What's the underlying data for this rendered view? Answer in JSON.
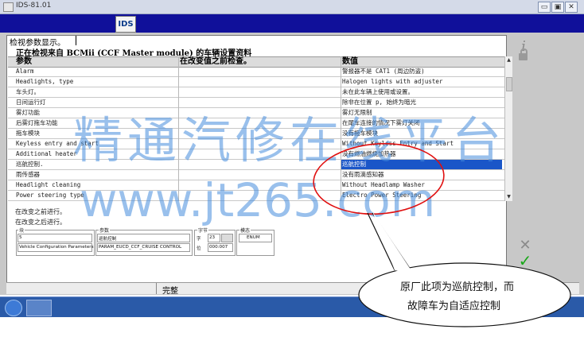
{
  "window": {
    "title": "IDS-81.01",
    "minimize": "▭",
    "restore": "▣",
    "close": "✕"
  },
  "toolbar": {
    "logo_label": "IDS"
  },
  "main": {
    "heading": "检视参数显示。",
    "subheading": "正在检视来自 BCMii (CCF Master module) 的车辆设置资料",
    "columns": [
      "参数",
      "在改变值之前检查。",
      "数值"
    ],
    "rows": [
      {
        "param": "Alarm",
        "value": "警报器不是 CAT1 (周边防盗)"
      },
      {
        "param": "Headlights, type",
        "value": "Halogen lights with adjuster"
      },
      {
        "param": "车头灯。",
        "value": "未在此车辆上使用或设置。"
      },
      {
        "param": "日间运行灯",
        "value": "除非在位置 p, 始终为暗光"
      },
      {
        "param": "雾灯功能",
        "value": "雾灯无限制"
      },
      {
        "param": "后雾灯拖车功能",
        "value": "在尾车连接的情况下雾灯关闭"
      },
      {
        "param": "拖车模块",
        "value": "没有拖车模块"
      },
      {
        "param": "Keyless entry and start",
        "value": "Without Keyless Entry and Start"
      },
      {
        "param": "Additional heater",
        "value": "没有燃油燃烧加热器"
      },
      {
        "param": "巡航控制.",
        "value": "巡航控制"
      },
      {
        "param": "雨传感器",
        "value": "没有雨滴感知器"
      },
      {
        "param": "Headlight cleaning",
        "value": "Without Headlamp Washer"
      },
      {
        "param": "Power steering type",
        "value": "Electro Power Steering"
      }
    ],
    "note1": "在改变之前进行。",
    "note2": "在改变之后进行。",
    "block": {
      "label": "块",
      "value": "5",
      "name": "Vehicle Configuration Parameters"
    },
    "param": {
      "label": "参数",
      "value": "巡航控制",
      "name": "PARAM_EUCD_CCF_CRUISE CONTROL"
    },
    "byte": {
      "label": "字节",
      "side_chars": [
        "字",
        "位"
      ],
      "value1": "23",
      "value2": "000:007"
    },
    "state": {
      "label": "模态",
      "value": "ENUM"
    }
  },
  "status": {
    "text": "完整"
  },
  "watermark": {
    "line1": "精通汽修在线平台",
    "line2": "www.jt265.com"
  },
  "callout": {
    "line1": "原厂此项为巡航控制，而",
    "line2": "故障车为自适应控制"
  },
  "icons": [
    "help-icon",
    "lock-icon",
    "cancel-icon",
    "confirm-icon"
  ]
}
